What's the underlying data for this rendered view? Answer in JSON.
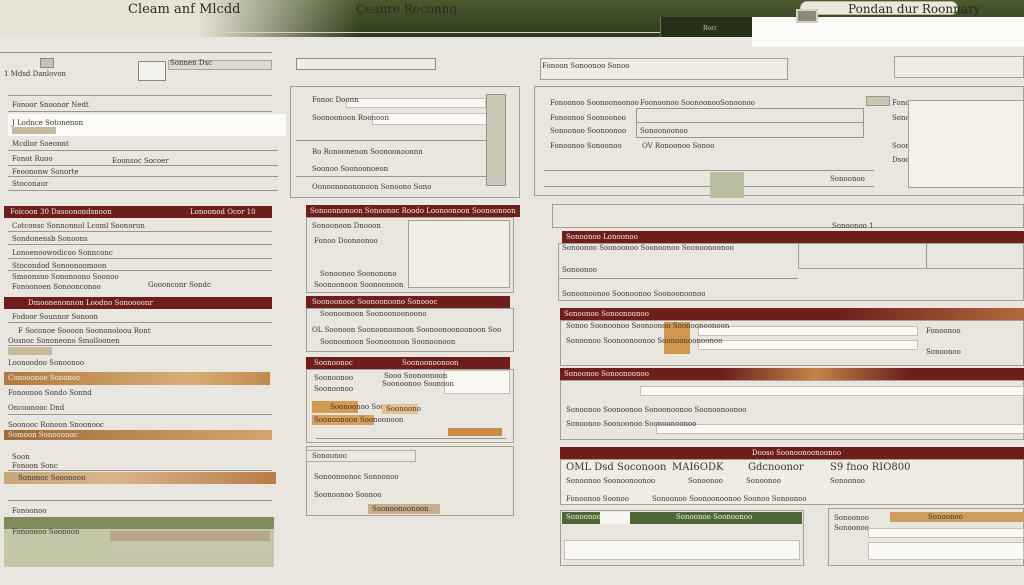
{
  "header": {
    "app_title": "Cleam anf Mlcdd",
    "center_title": "Ceanre Reconng",
    "right_title": "Pondan dur Roonnary",
    "tab_label": "Rorr"
  },
  "colors": {
    "title_bar": "#3c4a26",
    "accent_red": "#6e1f1c",
    "accent_green": "#4f6637",
    "accent_tan": "#c98b48",
    "paper": "#e9e6df"
  },
  "left": {
    "top_fields": [
      "1 Mdsd Danlovon",
      "Sonnen Dsc",
      "Fordlc Sone"
    ],
    "rows_a": [
      "Fonoor Snoonor Nedt",
      "J Lodnce Sotonenon",
      "Mcdlor Soeonnt",
      "Fonot Ruoo",
      "Feoononw Sonorte",
      "Stoconaor",
      "Fonconen Sondetomt"
    ],
    "side_a": [
      "Eoonsoc Socoer",
      "Dooclod Sonoons"
    ],
    "bar1": "Foicoon 30 Dasoonondsnoon",
    "bar1_right": "Lonoonod Ocor 10",
    "rows_b": [
      "Cotconsc Sonnonnol Lcoml Soonorun",
      "Sondonensb Sonoons",
      "Lonoenoowodicoo Sonnconc",
      "Stocondod Sonoonoomoon",
      "Smoonsuo Sononoono Soonoo",
      "Fonoonoen Sonoonconoo"
    ],
    "side_b": [
      "Gooonconr Sondc",
      "Mornoc Roonse"
    ],
    "bar2": "Dmoonenonnon Loodno Sonoooonr",
    "rows_c": [
      "Fodoor Sounnor Sonoon",
      "F Soconoe Soooon Soononoloou Ront",
      "Oosnoc Sononeono Smolloonen",
      "Loonoodoo Sonoonoo",
      "Conooonoe Sononoc",
      "Fonoonoo Sondo Sonnd",
      "Oncoonooc Dnd",
      "Soonooc Ronoon Snoonooc",
      "Somoon Sonooonoc",
      "Soon",
      "Fonoon Sonc",
      "Sononoc Sooonoon",
      "Fonoonoo",
      "Fonoonoo Soonoon"
    ]
  },
  "mid": {
    "top_fields": [
      "Fonoc Doonn",
      "Soonoonoon Roonoon",
      "Bo Ronoonenon Soonoonoonnn",
      "Soonoo Soonoonoeon",
      "Oonoononononoon Sonoono Sono"
    ],
    "bar1": "Sonoonnonoon Sonoonoc Roodo Loonoonoon Soonoonoon",
    "rows_a": [
      "Sonoonoon Dnooon",
      "Fonoo Doonoonoo",
      "Sonoonoo Soononono",
      "Soonoonoon Soonoonoon"
    ],
    "bar2": "Soonoonooc Soonoonoono Sonoooc",
    "rows_b": [
      "Soonoonoon Soonoonoonoono",
      "OL Soonoon Soonoonoonoon Soonoonoonoonoon Soo",
      "Soonoonoon Soonoonoon Soonoonoon"
    ],
    "bar3_left": "Soonoonoc",
    "bar3_right": "Soonoonoonoon",
    "rows_c": [
      "Soonoonoo",
      "Sooo Soonoonoon",
      "Soonoonoo Soonoon",
      "Soonoonoo",
      "Soonoonoo Soono",
      "Soonoonoon Soonoonoon",
      "Soonoono"
    ],
    "bottom": [
      "Sonoonoo",
      "Sonoonoonoc Sonoonoo",
      "Soonoonoo Soonoo",
      "Soonoonoonoon"
    ]
  },
  "right": {
    "top_label": "Fonoon Sonoonoo Sonoo",
    "rows_a": [
      "Fonoonoo Soonoonoonoo",
      "Fonoonoo Soonoonoo",
      "Sonoonoo Soonoonoo",
      "Fonoonoo Sonoonoo"
    ],
    "mid_labels": [
      "Sonoonoo",
      "Foonoonoo Soonoonoo",
      "Sonoonoonoo",
      "OV Ronoonoo Sonoo"
    ],
    "side_labels": [
      "Fonoonoo",
      "Sonoonoo",
      "Soonoo",
      "Dsoo"
    ],
    "bar1": "Sonoonoo Lonoonoo",
    "bar1_right": "Sonoonoo 1",
    "rows_b": [
      "Sonoonoo Soonoonoo Soonoonoo Soonoonoonoo",
      "Sonoonoo",
      "Sonoonoonoo Soonoonoo Soonoonoonoo"
    ],
    "bar2": "Sonoonoo Sonoonoonoo",
    "rows_c": [
      "Sonoo Soonoonoo Soonoonoo Soonoonoonoon",
      "Sonoonoo Soonoonoonoo Soonoonoonoonoo",
      "Fonoonoo",
      "Sonoonoo"
    ],
    "bar3": "Sonoonoo Sonoonoonoo",
    "rows_d": [
      "Sonoonoo Soonoonoo Sonoonoonoo Soonoonoonoo",
      "Sonoonoo Soonoonoo Soonoonoonoo"
    ],
    "summary_bar": "Dooso Soonoonoonoonoo",
    "summary_cols": [
      "OML Dsd Soconoon",
      "MAI6ODK",
      "Gdcnoonor",
      "S9 fnoo RIO800"
    ],
    "summary_row2": [
      "Sonoonoo Soonoonoonoo",
      "Sonoonoo",
      "Sonoonoo",
      "Sonoonoo"
    ],
    "summary_row3": [
      "Fonoonoo Soonoo",
      "Sonoonoo Soonoonoonoo Soonoo Sonoonoo"
    ],
    "footer_a": [
      "Sonoonoo",
      "Sonoonoo Soonoonoo"
    ],
    "footer_b": [
      "Sonoonoo",
      "Sonoonoo",
      "Sonoonoo"
    ]
  }
}
